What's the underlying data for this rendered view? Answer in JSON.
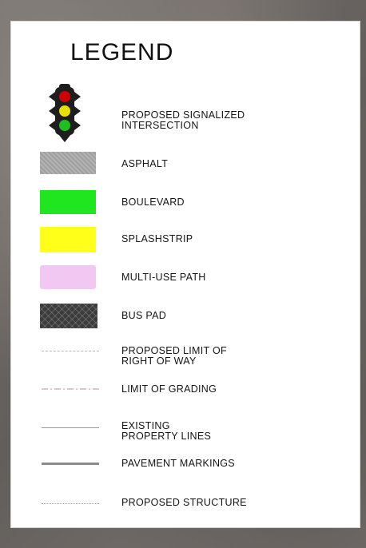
{
  "legend": {
    "title": "LEGEND",
    "items": [
      {
        "label": "PROPOSED SIGNALIZED\nINTERSECTION",
        "symbol": "traffic-signal-icon"
      },
      {
        "label": "ASPHALT",
        "symbol": "swatch",
        "color": "#a9a9a9"
      },
      {
        "label": "BOULEVARD",
        "symbol": "swatch",
        "color": "#1fe61f"
      },
      {
        "label": "SPLASHSTRIP",
        "symbol": "swatch",
        "color": "#ffff1a"
      },
      {
        "label": "MULTI-USE PATH",
        "symbol": "swatch",
        "color": "#f1c8f1"
      },
      {
        "label": "BUS PAD",
        "symbol": "hatched-swatch",
        "color": "#3c3c3c"
      },
      {
        "label": "PROPOSED LIMIT OF\nRIGHT OF WAY",
        "symbol": "dashed-line",
        "color": "#d9a5a5"
      },
      {
        "label": "LIMIT OF GRADING",
        "symbol": "dash-dot-line",
        "color": "#c88a8a"
      },
      {
        "label": "EXISTING\nPROPERTY LINES",
        "symbol": "thin-line",
        "color": "#9a9a9a"
      },
      {
        "label": "PAVEMENT MARKINGS",
        "symbol": "thick-line",
        "color": "#8a8a8a"
      },
      {
        "label": "PROPOSED STRUCTURE",
        "symbol": "dotted-line",
        "color": "#a0a0a0"
      }
    ]
  }
}
